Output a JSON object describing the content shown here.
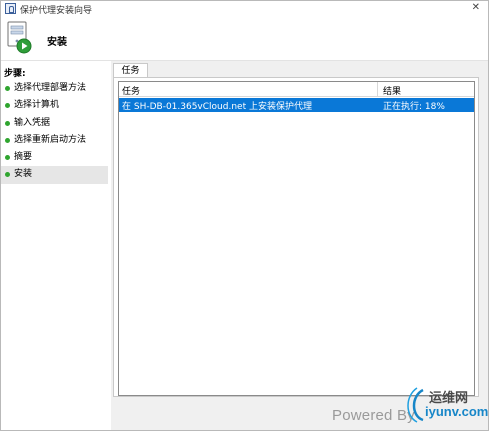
{
  "window": {
    "title": "保护代理安装向导",
    "close_glyph": "✕"
  },
  "header": {
    "title": "安装"
  },
  "steps": {
    "label": "步骤:",
    "items": [
      {
        "label": "选择代理部署方法"
      },
      {
        "label": "选择计算机"
      },
      {
        "label": "输入凭据"
      },
      {
        "label": "选择重新启动方法"
      },
      {
        "label": "摘要"
      },
      {
        "label": "安装"
      }
    ],
    "current_index": 5
  },
  "tabs": [
    {
      "label": "任务"
    }
  ],
  "grid": {
    "columns": [
      "任务",
      "结果"
    ],
    "rows": [
      {
        "task": "在 SH-DB-01.365vCloud.net 上安装保护代理",
        "result": "正在执行: 18%"
      }
    ]
  },
  "watermark": {
    "powered": "Powered By",
    "brand_cn": "运维网",
    "brand_en": "iyunv.com"
  },
  "colors": {
    "step_dot": "#2fa52f",
    "selected_row": "#0a78d7"
  }
}
